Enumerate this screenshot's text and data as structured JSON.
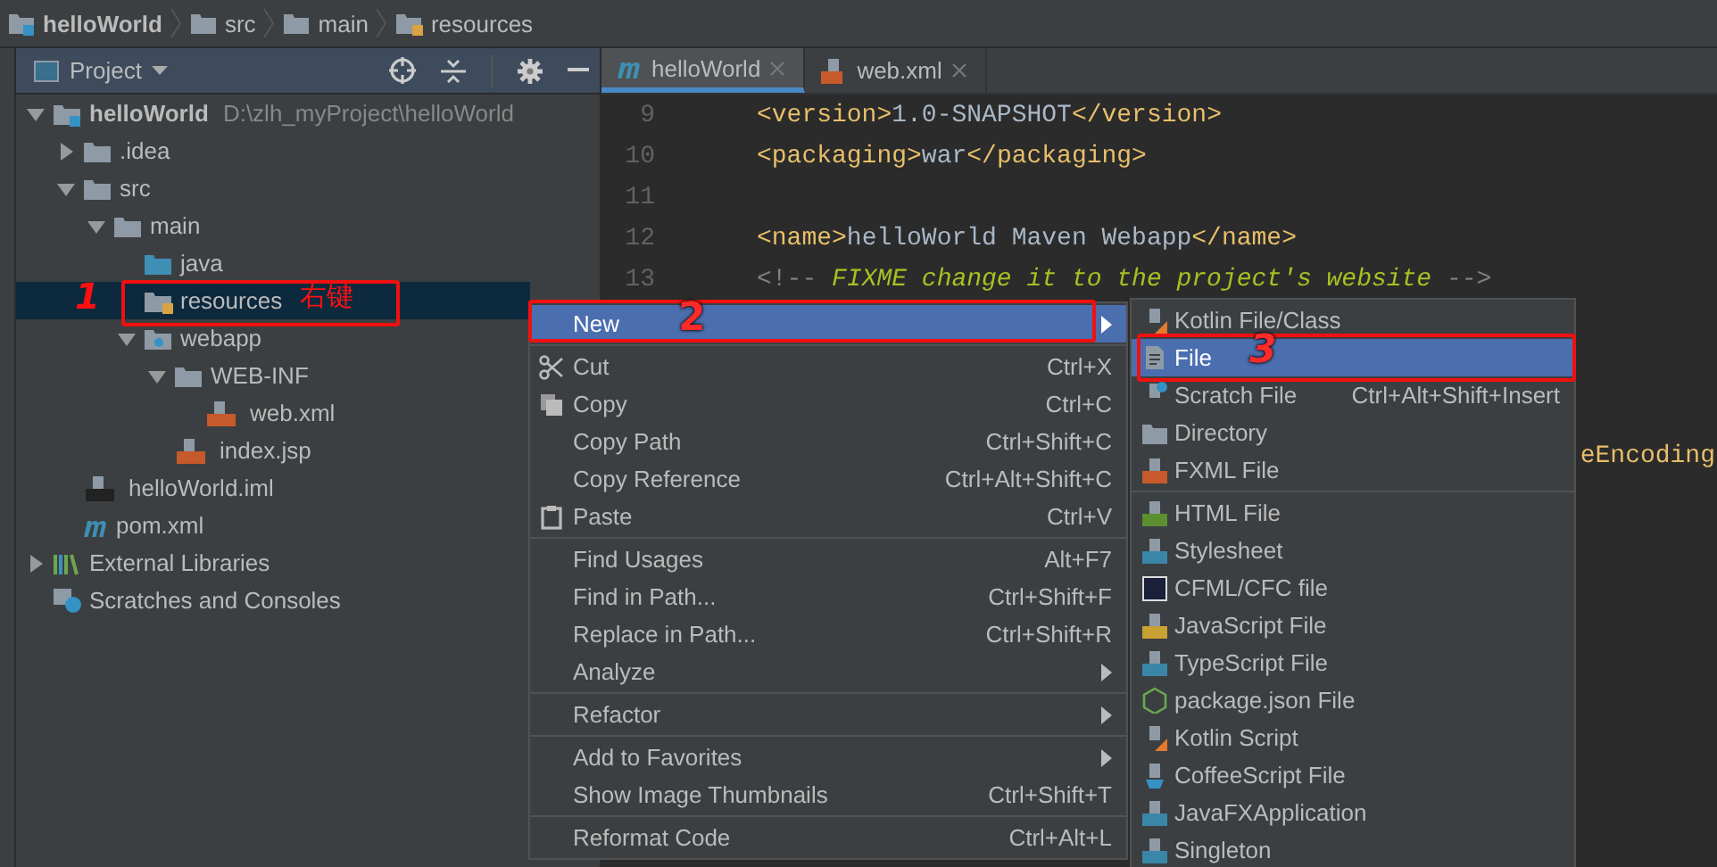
{
  "breadcrumb": [
    {
      "label": "helloWorld",
      "kind": "module"
    },
    {
      "label": "src",
      "kind": "folder"
    },
    {
      "label": "main",
      "kind": "folder"
    },
    {
      "label": "resources",
      "kind": "resources"
    }
  ],
  "project_panel": {
    "title": "Project",
    "tree": [
      {
        "label": "helloWorld",
        "path": "D:\\zlh_myProject\\helloWorld",
        "kind": "module",
        "expanded": true,
        "selected": false,
        "children": [
          {
            "label": ".idea",
            "kind": "folder",
            "expanded": false,
            "selected": false
          },
          {
            "label": "src",
            "kind": "folder",
            "expanded": true,
            "selected": false,
            "children": [
              {
                "label": "main",
                "kind": "folder",
                "expanded": true,
                "selected": false,
                "children": [
                  {
                    "label": "java",
                    "kind": "sources",
                    "selected": false
                  },
                  {
                    "label": "resources",
                    "kind": "resources",
                    "selected": true
                  },
                  {
                    "label": "webapp",
                    "kind": "web",
                    "expanded": true,
                    "selected": false,
                    "children": [
                      {
                        "label": "WEB-INF",
                        "kind": "folder",
                        "expanded": true,
                        "selected": false,
                        "children": [
                          {
                            "label": "web.xml",
                            "kind": "xml",
                            "selected": false
                          }
                        ]
                      },
                      {
                        "label": "index.jsp",
                        "kind": "jsp",
                        "selected": false
                      }
                    ]
                  }
                ]
              }
            ]
          },
          {
            "label": "helloWorld.iml",
            "kind": "iml",
            "selected": false
          },
          {
            "label": "pom.xml",
            "kind": "maven",
            "selected": false
          }
        ]
      },
      {
        "label": "External Libraries",
        "kind": "libraries",
        "expanded": false,
        "selected": false
      },
      {
        "label": "Scratches and Consoles",
        "kind": "scratches",
        "selected": false
      }
    ]
  },
  "editor": {
    "tabs": [
      {
        "label": "helloWorld",
        "kind": "maven",
        "selected": true
      },
      {
        "label": "web.xml",
        "kind": "xml",
        "selected": false
      }
    ],
    "lines": [
      {
        "number": "9",
        "segments": [
          {
            "kind": "tag",
            "text": "<version>"
          },
          {
            "kind": "text",
            "text": "1.0-SNAPSHOT"
          },
          {
            "kind": "tag",
            "text": "</version>"
          }
        ]
      },
      {
        "number": "10",
        "segments": [
          {
            "kind": "tag",
            "text": "<packaging>"
          },
          {
            "kind": "text",
            "text": "war"
          },
          {
            "kind": "tag",
            "text": "</packaging>"
          }
        ]
      },
      {
        "number": "11"
      },
      {
        "number": "12",
        "segments": [
          {
            "kind": "tag",
            "text": "<name>"
          },
          {
            "kind": "text",
            "text": "helloWorld Maven Webapp"
          },
          {
            "kind": "tag",
            "text": "</name>"
          }
        ]
      },
      {
        "number": "13",
        "segments": [
          {
            "kind": "comment",
            "text": "<!-- "
          },
          {
            "kind": "todo",
            "text": "FIXME change it to the project's website"
          },
          {
            "kind": "comment",
            "text": " -->"
          }
        ]
      }
    ],
    "hidden_line_tail": "eEncoding"
  },
  "context_menu": {
    "groups": [
      [
        {
          "label": "New",
          "submenu": true,
          "selected": true
        }
      ],
      [
        {
          "label": "Cut",
          "shortcut": "Ctrl+X",
          "kind": "cut",
          "selected": false
        },
        {
          "label": "Copy",
          "shortcut": "Ctrl+C",
          "kind": "copy",
          "selected": false
        },
        {
          "label": "Copy Path",
          "shortcut": "Ctrl+Shift+C",
          "selected": false
        },
        {
          "label": "Copy Reference",
          "shortcut": "Ctrl+Alt+Shift+C",
          "selected": false
        },
        {
          "label": "Paste",
          "shortcut": "Ctrl+V",
          "kind": "paste",
          "selected": false
        }
      ],
      [
        {
          "label": "Find Usages",
          "shortcut": "Alt+F7",
          "selected": false
        },
        {
          "label": "Find in Path...",
          "shortcut": "Ctrl+Shift+F",
          "selected": false
        },
        {
          "label": "Replace in Path...",
          "shortcut": "Ctrl+Shift+R",
          "selected": false
        },
        {
          "label": "Analyze",
          "submenu": true,
          "selected": false
        }
      ],
      [
        {
          "label": "Refactor",
          "submenu": true,
          "selected": false
        }
      ],
      [
        {
          "label": "Add to Favorites",
          "submenu": true,
          "selected": false
        },
        {
          "label": "Show Image Thumbnails",
          "shortcut": "Ctrl+Shift+T",
          "selected": false
        }
      ],
      [
        {
          "label": "Reformat Code",
          "shortcut": "Ctrl+Alt+L",
          "selected": false
        }
      ]
    ]
  },
  "new_submenu": {
    "groups": [
      [
        {
          "label": "Kotlin File/Class",
          "kind": "kotlin",
          "selected": false
        },
        {
          "label": "File",
          "kind": "file",
          "selected": true
        },
        {
          "label": "Scratch File",
          "shortcut": "Ctrl+Alt+Shift+Insert",
          "kind": "scratch",
          "selected": false
        },
        {
          "label": "Directory",
          "kind": "folder",
          "selected": false
        },
        {
          "label": "FXML File",
          "kind": "xml",
          "selected": false
        }
      ],
      [
        {
          "label": "HTML File",
          "kind": "html",
          "selected": false
        },
        {
          "label": "Stylesheet",
          "kind": "css",
          "selected": false
        },
        {
          "label": "CFML/CFC file",
          "kind": "cf",
          "selected": false
        },
        {
          "label": "JavaScript File",
          "kind": "js",
          "selected": false
        },
        {
          "label": "TypeScript File",
          "kind": "ts",
          "selected": false
        },
        {
          "label": "package.json File",
          "kind": "node",
          "selected": false
        },
        {
          "label": "Kotlin Script",
          "kind": "kotlin",
          "selected": false
        },
        {
          "label": "CoffeeScript File",
          "kind": "coffee",
          "selected": false
        },
        {
          "label": "JavaFXApplication",
          "kind": "java",
          "selected": false
        },
        {
          "label": "Singleton",
          "kind": "java",
          "selected": false
        }
      ]
    ]
  },
  "annotations": [
    {
      "label": "1"
    },
    {
      "label": "右键"
    },
    {
      "label": "2"
    },
    {
      "label": "3"
    }
  ]
}
